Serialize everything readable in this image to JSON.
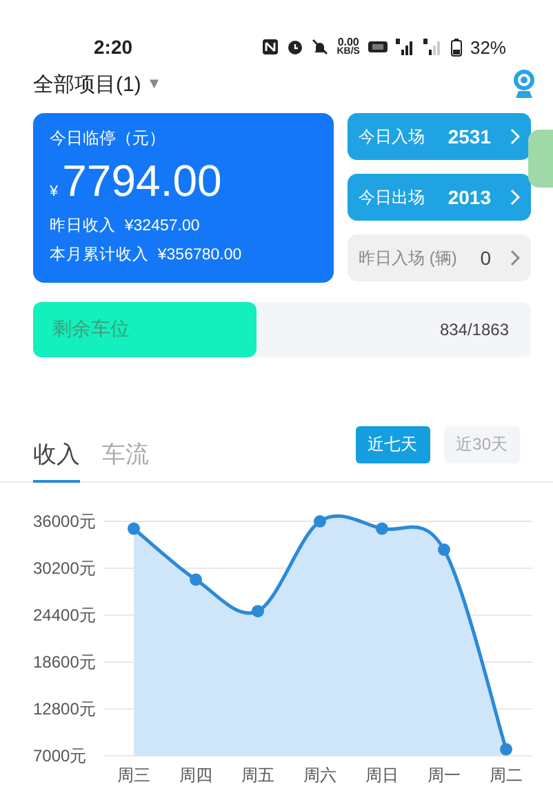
{
  "status_bar": {
    "time": "2:20",
    "net_speed": "0.00",
    "net_unit": "KB/S",
    "battery": "32%"
  },
  "header": {
    "project": "全部项目(1)",
    "dropdown": "▼"
  },
  "income_card": {
    "title": "今日临停（元）",
    "currency": "¥",
    "amount": "7794.00",
    "lines": [
      "昨日收入  ¥32457.00",
      "本月累计收入  ¥356780.00"
    ]
  },
  "stat_buttons": [
    {
      "label": "今日入场",
      "value": "2531",
      "kind": "primary"
    },
    {
      "label": "今日出场",
      "value": "2013",
      "kind": "primary"
    },
    {
      "label": "昨日入场 (辆)",
      "value": "0",
      "kind": "muted"
    }
  ],
  "remaining": {
    "label": "剩余车位",
    "reading": "834/1863",
    "level": 0.448
  },
  "tabs": [
    {
      "label": "收入",
      "selected": true
    },
    {
      "label": "车流",
      "selected": false
    }
  ],
  "ranges": [
    {
      "label": "近七天",
      "selected": true
    },
    {
      "label": "近30天",
      "selected": false
    }
  ],
  "chart": {
    "chart_data": {
      "type": "area",
      "categories": [
        "周三",
        "周四",
        "周五",
        "周六",
        "周日",
        "周一",
        "周二"
      ],
      "series": [
        {
          "color": "#2b8ad8",
          "values": [
            35100,
            28800,
            24900,
            36000,
            35100,
            32500,
            7800
          ]
        }
      ],
      "grid": true,
      "ylim": [
        7000,
        36000
      ],
      "yticks": [
        {
          "value": 36000,
          "label": "36000元"
        },
        {
          "value": 30200,
          "label": "30200元"
        },
        {
          "value": 24400,
          "label": "24400元"
        },
        {
          "value": 18600,
          "label": "18600元"
        },
        {
          "value": 12800,
          "label": "12800元"
        },
        {
          "value": 7000,
          "label": "7000元"
        }
      ]
    }
  }
}
